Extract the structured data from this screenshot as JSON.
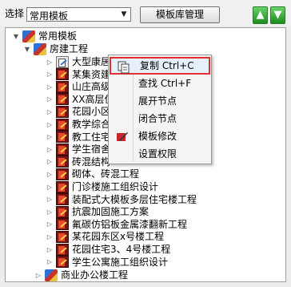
{
  "toolbar": {
    "select_label": "选择",
    "select_value": "常用模板",
    "manager_button": "模板库管理",
    "up_arrow": "▲",
    "down_arrow": "▼",
    "dropdown_arrow": "▼"
  },
  "tree": {
    "expander_open": "▼",
    "expander_closed": "▷",
    "root": "常用模板",
    "group": "房建工程",
    "items": [
      "大型康居住宅小区",
      "某集资建房施工组织设计",
      "山庄高级住宅施工组织设计",
      "XX高层住宅楼施工组织设计",
      "花园小区",
      "教学综合楼",
      "教工住宅",
      "学生宿舍",
      "砖混结构",
      "砌体、砖混工程",
      "门诊楼施工组织设计",
      "装配式大模板多层住宅楼工程",
      "抗震加固施工方案",
      "氟碳仿铝板金属漆翻新工程",
      "某花园东区x号楼工程",
      "花园住宅3、4号楼工程",
      "学生公寓施工组织设计"
    ],
    "next_group": "商业办公楼工程"
  },
  "context_menu": {
    "items": [
      {
        "label": "复制 Ctrl+C",
        "icon": "copy-icon"
      },
      {
        "label": "查找 Ctrl+F",
        "icon": ""
      },
      {
        "label": "展开节点",
        "icon": ""
      },
      {
        "label": "闭合节点",
        "icon": ""
      },
      {
        "label": "模板修改",
        "icon": "edit-icon"
      },
      {
        "label": "设置权限",
        "icon": ""
      }
    ]
  }
}
